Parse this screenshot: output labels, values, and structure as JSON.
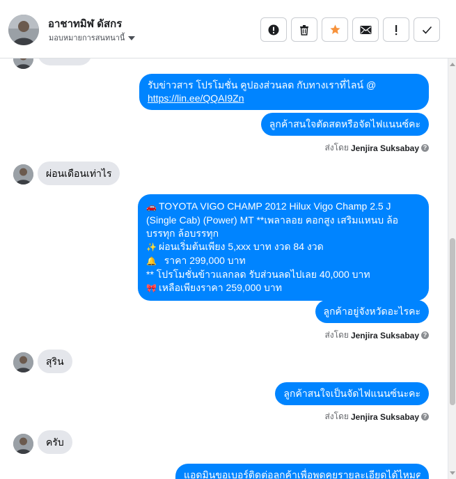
{
  "header": {
    "contact_name": "อาชาทมิฬ ดัสกร",
    "assign_label": "มอบหมายการสนทนานี้",
    "actions": [
      {
        "name": "report-spam-button",
        "icon": "alert-circle-icon"
      },
      {
        "name": "delete-button",
        "icon": "trash-icon"
      },
      {
        "name": "star-button",
        "icon": "star-icon"
      },
      {
        "name": "mark-unread-button",
        "icon": "envelope-icon"
      },
      {
        "name": "follow-up-button",
        "icon": "exclamation-icon"
      },
      {
        "name": "mark-done-button",
        "icon": "check-icon"
      }
    ]
  },
  "colors": {
    "accent": "#0084ff",
    "incoming_bubble": "#e4e6eb",
    "star": "#f7923b"
  },
  "thread": {
    "out1": {
      "line1": "รับข่าวสาร โปรโมชั่น คูปองส่วนลด กับทางเราที่ไลน์ @",
      "link": "https://lin.ee/QQAI9Zn"
    },
    "out2": "ลูกค้าสนใจตัดสดหรือจัดไฟแนนซ์คะ",
    "sent_by_1": {
      "prefix": "ส่งโดย",
      "name": "Jenjira Suksabay"
    },
    "in1": "ผ่อนเดือนเท่าไร",
    "out3": {
      "icons": {
        "car": "car-icon",
        "sparkle": "sparkles-icon",
        "bell": "bell-icon",
        "ribbon": "ribbon-icon"
      },
      "line1": "TOYOTA VIGO CHAMP 2012 Hilux Vigo Champ 2.5 J",
      "line2": "(Single Cab) (Power) MT **เพลาลอย คอกสูง เสริมแหนบ ล้อ",
      "line3": "บรรทุก ล้อบรรทุก",
      "line4": "ผ่อนเริ่มต้นเพียง 5,xxx บาท งวด 84 งวด",
      "line5": "ราคา 299,000 บาท",
      "line6": "** โปรโมชั่นข้าวแลกลด รับส่วนลดไปเลย 40,000 บาท",
      "line7": "เหลือเพียงราคา 259,000 บาท"
    },
    "out4": "ลูกค้าอยู่จังหวัดอะไรคะ",
    "sent_by_2": {
      "prefix": "ส่งโดย",
      "name": "Jenjira Suksabay"
    },
    "in2": "สุริน",
    "out5": "ลูกค้าสนใจเป็นจัดไฟแนนซ์นะคะ",
    "sent_by_3": {
      "prefix": "ส่งโดย",
      "name": "Jenjira Suksabay"
    },
    "in3": "ครับ",
    "out6": "แอดมินขอเบอร์ติดต่อลูกค้าเพื่อพูดคุยรายละเอียดได้ไหมคะ"
  }
}
